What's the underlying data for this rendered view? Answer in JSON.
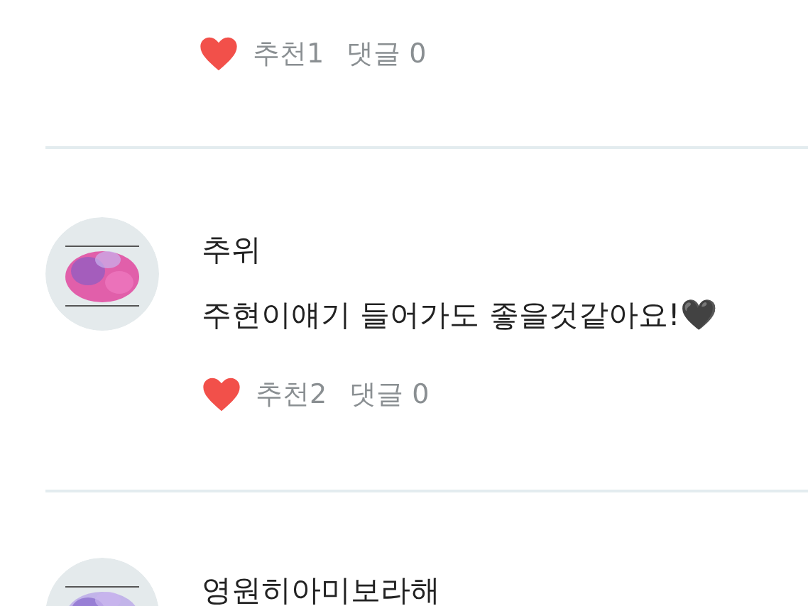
{
  "comments": [
    {
      "kind": "stats_only",
      "liked": true,
      "likes": "추천1",
      "replies": "댓글 0"
    },
    {
      "kind": "full",
      "author": "추위",
      "text": "주현이얘기 들어가도 좋을것같아요!🖤",
      "liked": true,
      "likes": "추천2",
      "replies": "댓글 0"
    },
    {
      "kind": "header_only",
      "author": "영원히아미보라해"
    }
  ]
}
